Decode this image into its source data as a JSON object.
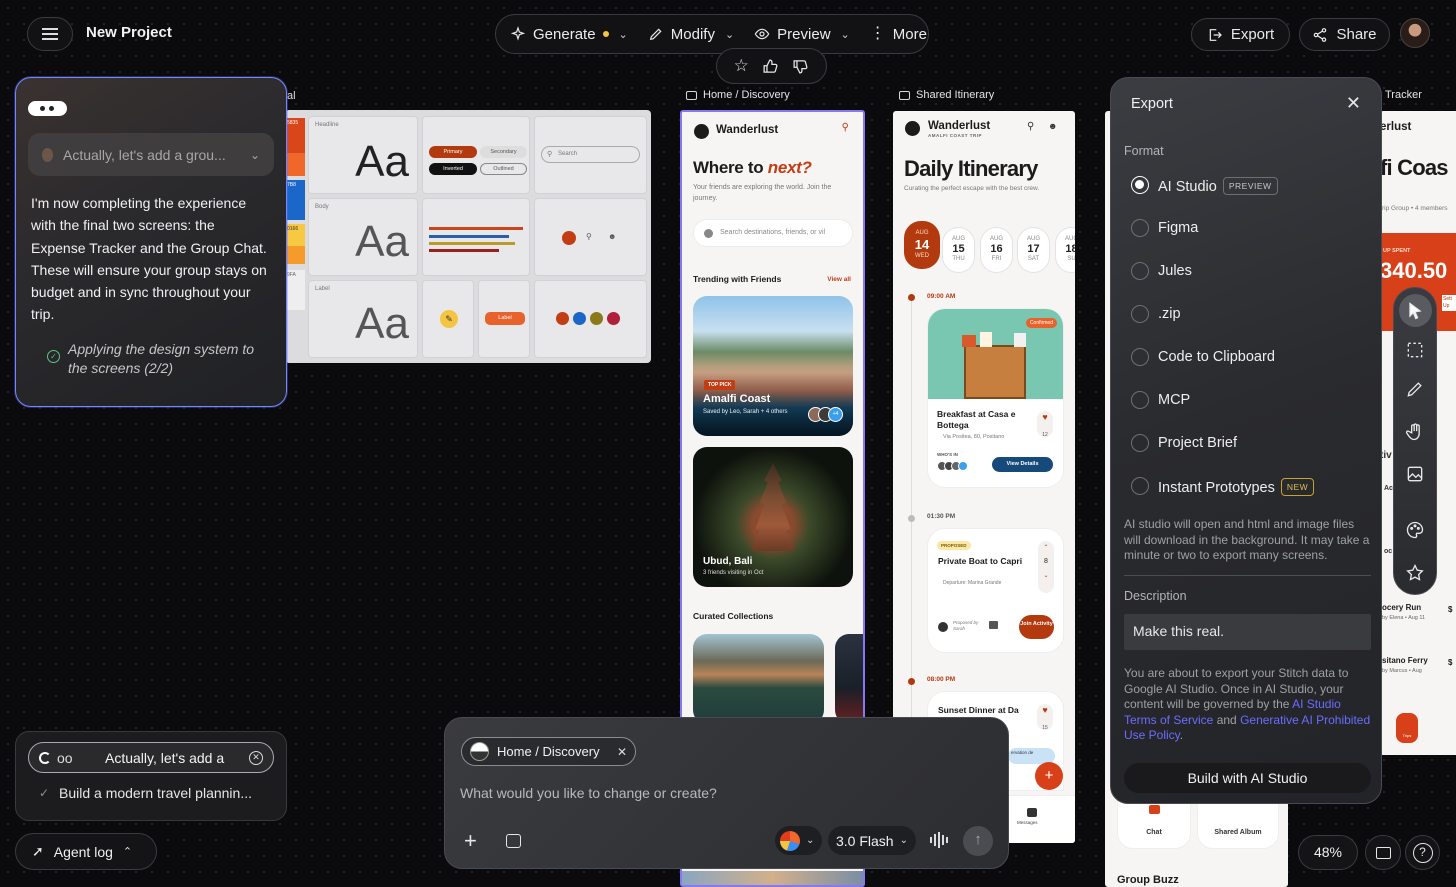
{
  "header": {
    "project_title": "New Project",
    "actions": {
      "generate": "Generate",
      "modify": "Modify",
      "preview": "Preview",
      "more": "More"
    },
    "export": "Export",
    "share": "Share"
  },
  "agent": {
    "input_preview": "Actually, let's add a grou...",
    "message": "I'm now completing the experience with the final two screens: the Expense Tracker and the Group Chat. These will ensure your group stays on budget and in sync throughout your trip.",
    "status": "Applying the design system to the screens (2/2)"
  },
  "queue": {
    "running_prefix": "oo",
    "running_text": "Actually, let's add a",
    "done_text": "Build a modern travel plannin..."
  },
  "agent_log": "Agent log",
  "design_system": {
    "label_partial": "al",
    "headline": "Headline",
    "body": "Body",
    "label": "Label",
    "sample": "Aa",
    "primary": "Primary",
    "secondary": "Secondary",
    "inverted": "Inverted",
    "outlined": "Outlined",
    "search": "Search",
    "label_chip": "Label",
    "swatches": [
      "5835",
      "7B8",
      "0166",
      "9FA"
    ]
  },
  "screens": {
    "home": {
      "label": "Home / Discovery",
      "brand": "Wanderlust",
      "hero_a": "Where to ",
      "hero_b": "next?",
      "subtitle": "Your friends are exploring the world. Join the journey.",
      "search_placeholder": "Search destinations, friends, or vil",
      "trending": "Trending with Friends",
      "view_all": "View all",
      "top_pick": "TOP PICK",
      "amalfi_title": "Amalfi Coast",
      "amalfi_meta": "Saved by Leo, Sarah + 4 others",
      "avatars_more": "+4",
      "ubud_title": "Ubud, Bali",
      "ubud_meta": "3 friends visiting in Oct",
      "collections": "Curated Collections"
    },
    "itinerary": {
      "label": "Shared Itinerary",
      "brand": "Wanderlust",
      "brand_sub": "AMALFI COAST TRIP",
      "title": "Daily Itinerary",
      "subtitle": "Curating the perfect escape with the best crew.",
      "dates": [
        {
          "m": "AUG",
          "d": "14",
          "w": "WED"
        },
        {
          "m": "AUG",
          "d": "15",
          "w": "THU"
        },
        {
          "m": "AUG",
          "d": "16",
          "w": "FRI"
        },
        {
          "m": "AUG",
          "d": "17",
          "w": "SAT"
        },
        {
          "m": "AUG",
          "d": "18",
          "w": "SU"
        }
      ],
      "t1": "09:00 AM",
      "confirmed": "Confirmed",
      "breakfast": "Breakfast at Casa e Bottega",
      "breakfast_addr": "Via Positea, 80, Positano",
      "likes1": "12",
      "whos_in": "WHO'S IN",
      "view_details": "View Details",
      "t2": "01:30 PM",
      "proposed": "PROPOSED",
      "boat": "Private Boat to Capri",
      "boat_meta": "Departure: Marina Grande",
      "votes": "8",
      "proposed_by": "Proposed by Sarah",
      "join": "Join Activity",
      "t3": "08:00 PM",
      "sunset": "Sunset Dinner at Da",
      "likes3": "15",
      "reservation": "ervation de",
      "messages": "Messages"
    },
    "tracker": {
      "label": "Tracker",
      "brand": "erlust",
      "title": "fi Coas",
      "group": "rip Group • 4 members",
      "spent_label": "UP SPENT",
      "spent": "340.50",
      "items": [
        {
          "name": "ocery Run",
          "meta": "by Elena • Aug 11",
          "amt": "$"
        },
        {
          "name": "sitano Ferry",
          "meta": "by Marcus • Aug",
          "amt": "$"
        }
      ],
      "ac": "Ac",
      "oc": "oc",
      "tiv": "tiv",
      "trips": "Trips",
      "sett": "Sett Up"
    },
    "group": {
      "chat": "Chat",
      "album": "Shared Album",
      "buzz": "Group Buzz"
    }
  },
  "export_panel": {
    "title": "Export",
    "format_label": "Format",
    "options": [
      {
        "label": "AI Studio",
        "badge": "PREVIEW"
      },
      {
        "label": "Figma"
      },
      {
        "label": "Jules"
      },
      {
        "label": ".zip"
      },
      {
        "label": "Code to Clipboard"
      },
      {
        "label": "MCP"
      },
      {
        "label": "Project Brief"
      },
      {
        "label": "Instant Prototypes",
        "badge": "NEW"
      }
    ],
    "info": "AI studio will open and html and image files will download in the background. It may take a minute or two to export many screens.",
    "description_label": "Description",
    "description_value": "Make this real.",
    "legal_a": "You are about to export your Stitch data to Google AI Studio. Once in AI Studio, your content will be governed by the ",
    "legal_link1": "AI Studio Terms of Service",
    "legal_and": " and ",
    "legal_link2": "Generative AI Prohibited Use Policy",
    "legal_end": ".",
    "build": "Build with AI Studio"
  },
  "composer": {
    "chip": "Home / Discovery",
    "placeholder": "What would you like to change or create?",
    "model": "3.0 Flash"
  },
  "zoom": "48%",
  "help": "?",
  "colors": {
    "accent": "#b23a0e",
    "selection": "#7b6cf0",
    "link": "#6c6cff"
  }
}
